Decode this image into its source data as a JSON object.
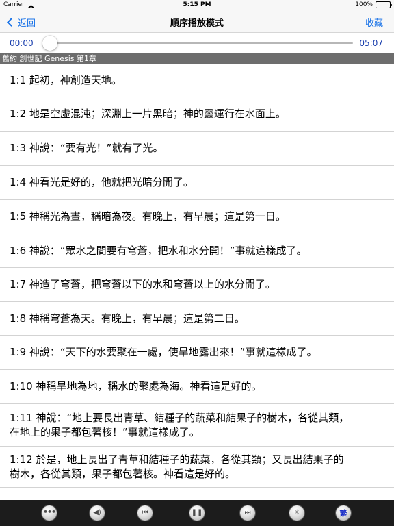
{
  "status": {
    "carrier": "Carrier",
    "time": "5:15 PM",
    "battery": "100%",
    "battery_level": 1.0
  },
  "nav": {
    "back_label": "返回",
    "title": "順序播放模式",
    "favorite_label": "收藏"
  },
  "player": {
    "current_time": "00:00",
    "total_time": "05:07",
    "progress": 0.0
  },
  "chapter": {
    "label": "舊約 創世記  Genesis  第1章"
  },
  "verses": [
    {
      "lines": [
        "1:1 起初，神創造天地。"
      ]
    },
    {
      "lines": [
        "1:2 地是空虛混沌；深淵上一片黑暗；神的靈運行在水面上。"
      ]
    },
    {
      "lines": [
        "1:3 神說：“要有光！”就有了光。"
      ]
    },
    {
      "lines": [
        "1:4 神看光是好的，他就把光暗分開了。"
      ]
    },
    {
      "lines": [
        "1:5 神稱光為晝，稱暗為夜。有晚上，有早晨；這是第一日。"
      ]
    },
    {
      "lines": [
        "1:6 神說：“眾水之間要有穹蒼，把水和水分開！”事就這樣成了。"
      ]
    },
    {
      "lines": [
        "1:7 神造了穹蒼，把穹蒼以下的水和穹蒼以上的水分開了。"
      ]
    },
    {
      "lines": [
        "1:8 神稱穹蒼為天。有晚上，有早晨；這是第二日。"
      ]
    },
    {
      "lines": [
        "1:9 神說：“天下的水要聚在一處，使旱地露出來！”事就這樣成了。"
      ]
    },
    {
      "lines": [
        "1:10 神稱旱地為地，稱水的聚處為海。神看這是好的。"
      ]
    },
    {
      "lines": [
        "1:11 神說：“地上要長出青草、結種子的蔬菜和結果子的樹木，各從其類，",
        "在地上的果子都包著核！”事就這樣成了。"
      ]
    },
    {
      "lines": [
        "1:12 於是，地上長出了青草和結種子的蔬菜，各從其類；又長出結果子的",
        "樹木，各從其類，果子都包著核。神看這是好的。"
      ]
    }
  ],
  "toolbar": {
    "items": [
      {
        "name": "more-button",
        "icon": "more-dots-icon",
        "glyph": "•••"
      },
      {
        "name": "volume-button",
        "icon": "speaker-icon",
        "glyph": "◀)"
      },
      {
        "name": "previous-button",
        "icon": "skip-back-icon",
        "glyph": "⏮"
      },
      {
        "name": "pause-button",
        "icon": "pause-icon",
        "glyph": "❚❚"
      },
      {
        "name": "next-button",
        "icon": "skip-forward-icon",
        "glyph": "⏭"
      },
      {
        "name": "brightness-button",
        "icon": "sun-icon",
        "glyph": "☼"
      },
      {
        "name": "traditional-chinese-button",
        "icon": "traditional-text-icon",
        "glyph": "繁"
      }
    ]
  },
  "colors": {
    "accent": "#1a73e8",
    "time_text": "#1a3fae",
    "chapter_bar": "#6d6d6d",
    "toolbar_bg": "#1c1c1c",
    "trad_text": "#1a2ec8"
  }
}
